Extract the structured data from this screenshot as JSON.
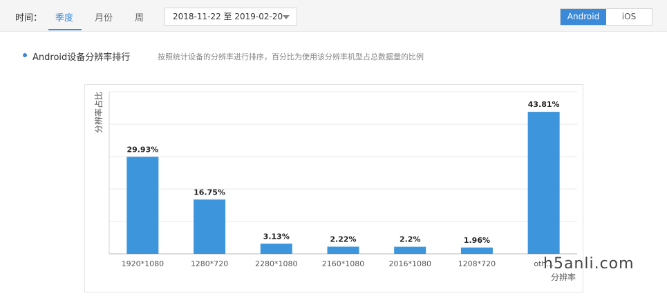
{
  "filters": {
    "time_label": "时间：",
    "tabs": [
      {
        "label": "季度",
        "active": true
      },
      {
        "label": "月份",
        "active": false
      },
      {
        "label": "周",
        "active": false
      }
    ],
    "date_range": "2018-11-22 至 2019-02-20"
  },
  "os_toggle": {
    "options": [
      {
        "label": "Android",
        "active": true
      },
      {
        "label": "iOS",
        "active": false
      }
    ]
  },
  "section": {
    "title": "Android设备分辨率排行",
    "description": "按照统计设备的分辨率进行排序，百分比为使用该分辨率机型占总数据量的比例"
  },
  "watermark": "h5anli.com",
  "colors": {
    "accent": "#3b8ad9",
    "bar": "#3d96dc",
    "grid": "#e8e8e8"
  },
  "chart_data": {
    "type": "bar",
    "categories": [
      "1920*1080",
      "1280*720",
      "2280*1080",
      "2160*1080",
      "2016*1080",
      "1208*720",
      "oth..."
    ],
    "values": [
      29.93,
      16.75,
      3.13,
      2.22,
      2.2,
      1.96,
      43.81
    ],
    "data_labels": [
      "29.93%",
      "16.75%",
      "3.13%",
      "2.22%",
      "2.2%",
      "1.96%",
      "43.81%"
    ],
    "xlabel": "分辨率",
    "ylabel": "分辨率占比",
    "ylim": [
      0,
      50
    ],
    "grid": true,
    "grid_step": 10
  }
}
